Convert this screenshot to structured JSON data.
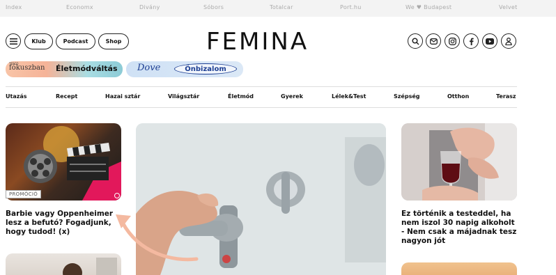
{
  "topbar": {
    "links": [
      "Index",
      "Economx",
      "Divány",
      "Sóbors",
      "Totalcar",
      "Port.hu",
      "We ♥ Budapest",
      "Velvet"
    ]
  },
  "header": {
    "menu_icon": "menu-icon",
    "buttons": [
      "Klub",
      "Podcast",
      "Shop"
    ],
    "logo": "FEMINA",
    "social_icons": [
      "search-icon",
      "mail-icon",
      "instagram-icon",
      "facebook-icon",
      "youtube-icon",
      "user-icon"
    ]
  },
  "sponsors": {
    "first_small": "fókuszban",
    "first_small_prefix": "TESCO",
    "first_big": "Életmódváltás",
    "second_brand": "Dove",
    "second_label": "Önbizalom"
  },
  "nav": [
    "Utazás",
    "Recept",
    "Hazai sztár",
    "Világsztár",
    "Életmód",
    "Gyerek",
    "Lélek&Test",
    "Szépség",
    "Otthon",
    "Terasz"
  ],
  "articles": {
    "left": {
      "badge": "PROMÓCIÓ",
      "title": "Barbie vagy Oppenheimer lesz a befutó? Fogadjunk, hogy tudod! (x)"
    },
    "right": {
      "title": "Ez történik a testeddel, ha nem iszol 30 napig alkoholt - Nem csak a májadnak tesz nagyon jót"
    }
  },
  "colors": {
    "accent_promo": "#e2185b",
    "arrow": "#f4b9a0"
  }
}
